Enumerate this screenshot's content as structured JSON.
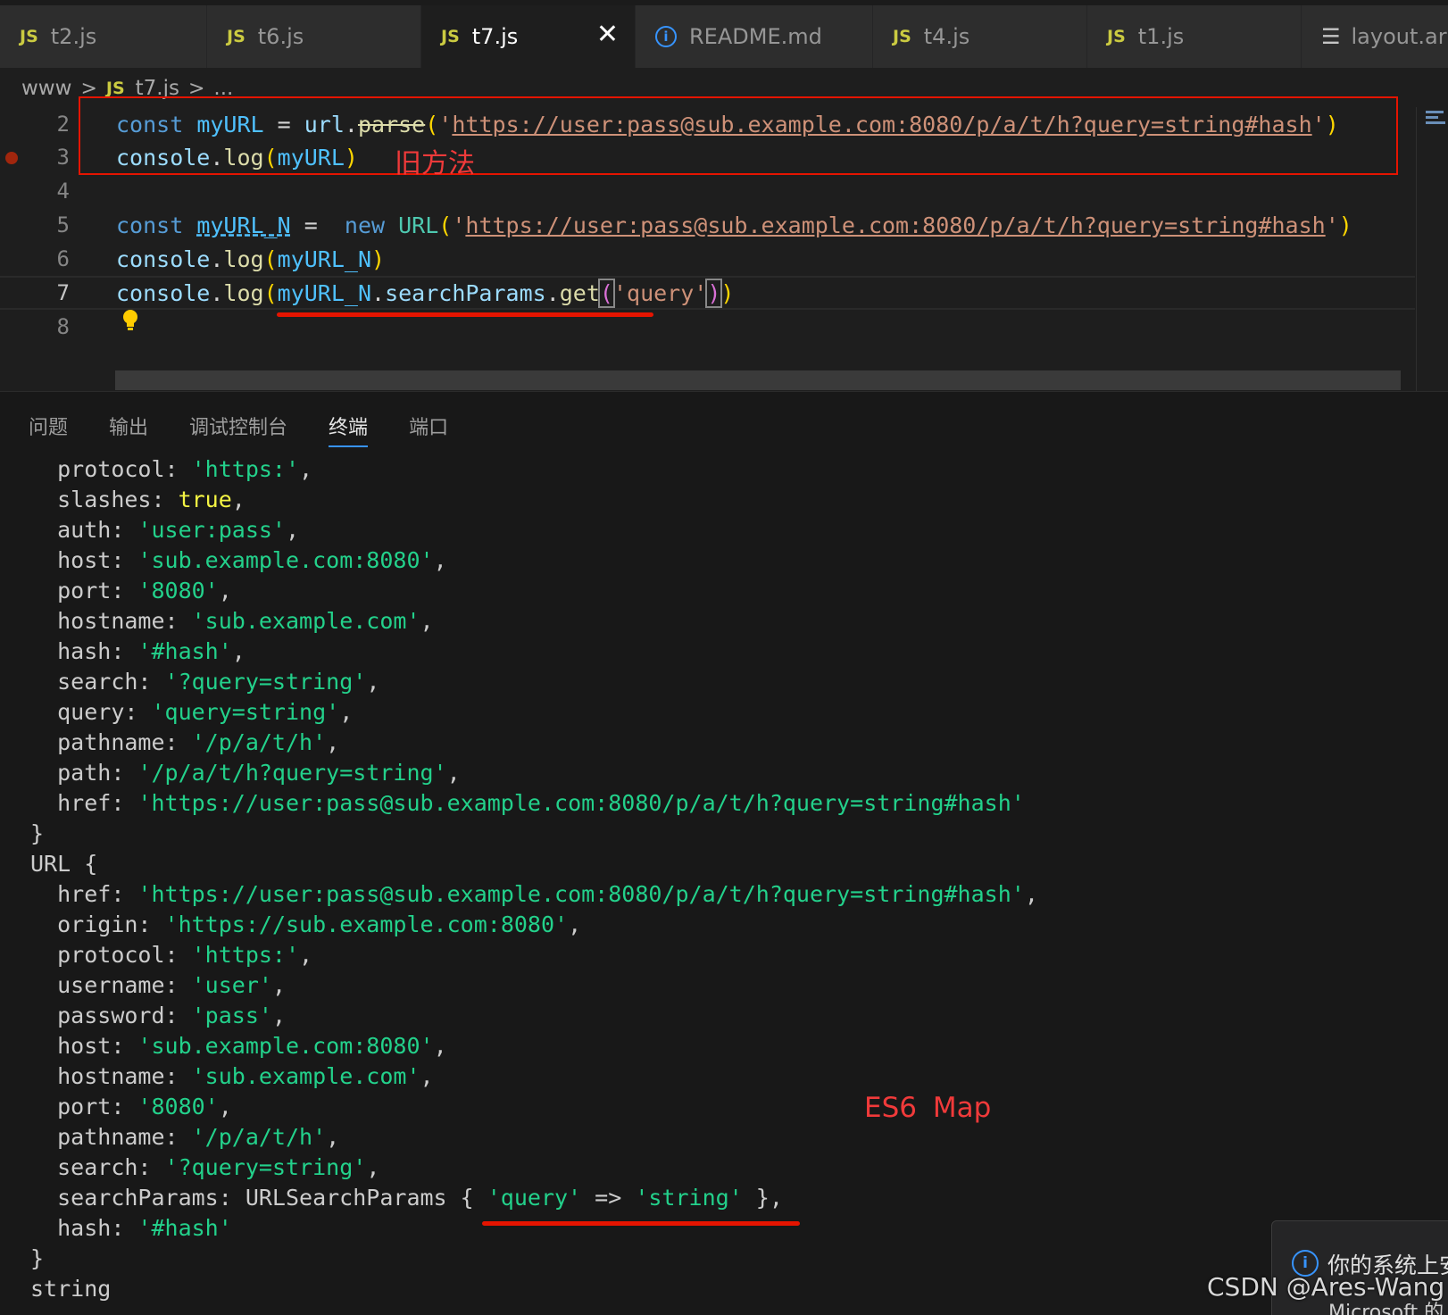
{
  "tabs": [
    {
      "icon": "JS",
      "label": "t2.js"
    },
    {
      "icon": "JS",
      "label": "t6.js"
    },
    {
      "icon": "JS",
      "label": "t7.js",
      "active": true,
      "close": "✕"
    },
    {
      "icon": "i",
      "label": "README.md"
    },
    {
      "icon": "JS",
      "label": "t4.js"
    },
    {
      "icon": "JS",
      "label": "t1.js"
    },
    {
      "icon": "☰",
      "label": "layout.ar"
    }
  ],
  "breadcrumb": {
    "folder": "www",
    "sep": ">",
    "file_icon": "JS",
    "file": "t7.js",
    "more": "..."
  },
  "editor": {
    "line_numbers": [
      "2",
      "3",
      "4",
      "5",
      "6",
      "7",
      "8"
    ],
    "annotation_old": "旧方法",
    "line2": {
      "t1": "const",
      "t2": "myURL",
      "t3": " = ",
      "t4": "url",
      "t5": ".",
      "t6": "parse",
      "t7": "(",
      "t8": "'",
      "t9": "https://user:pass@sub.example.com:8080/p/a/t/h?query=string#hash",
      "t10": "'",
      "t11": ")"
    },
    "line3": {
      "t1": "console",
      "t2": ".",
      "t3": "log",
      "t4": "(",
      "t5": "myURL",
      "t6": ")"
    },
    "line5": {
      "t1": "const",
      "t2": "myURL_N",
      "t3": " =  ",
      "t4": "new",
      "t5": "URL",
      "t6": "(",
      "t7": "'",
      "t8": "https://user:pass@sub.example.com:8080/p/a/t/h?query=string#hash",
      "t9": "'",
      "t10": ")"
    },
    "line6": {
      "t1": "console",
      "t2": ".",
      "t3": "log",
      "t4": "(",
      "t5": "myURL_N",
      "t6": ")"
    },
    "line7": {
      "t1": "console",
      "t2": ".",
      "t3": "log",
      "t4": "(",
      "t5": "myURL_N",
      "t6": ".",
      "t7": "searchParams",
      "t8": ".",
      "t9": "get",
      "t10": "(",
      "t11": "'query'",
      "t12": ")",
      "t13": ")"
    }
  },
  "panel": {
    "tabs": [
      "问题",
      "输出",
      "调试控制台",
      "终端",
      "端口"
    ],
    "active_tab": "终端",
    "annotation_es6": "ES6  Map",
    "notification": "你的系统上安",
    "watermark": "CSDN @Ares-Wang",
    "watermark2": "Microsoft 的"
  },
  "terminal": [
    {
      "indent": "  ",
      "key": "protocol: ",
      "val": "'https:'",
      "tail": ","
    },
    {
      "indent": "  ",
      "key": "slashes: ",
      "kw": "true",
      "tail": ","
    },
    {
      "indent": "  ",
      "key": "auth: ",
      "val": "'user:pass'",
      "tail": ","
    },
    {
      "indent": "  ",
      "key": "host: ",
      "val": "'sub.example.com:8080'",
      "tail": ","
    },
    {
      "indent": "  ",
      "key": "port: ",
      "val": "'8080'",
      "tail": ","
    },
    {
      "indent": "  ",
      "key": "hostname: ",
      "val": "'sub.example.com'",
      "tail": ","
    },
    {
      "indent": "  ",
      "key": "hash: ",
      "val": "'#hash'",
      "tail": ","
    },
    {
      "indent": "  ",
      "key": "search: ",
      "val": "'?query=string'",
      "tail": ","
    },
    {
      "indent": "  ",
      "key": "query: ",
      "val": "'query=string'",
      "tail": ","
    },
    {
      "indent": "  ",
      "key": "pathname: ",
      "val": "'/p/a/t/h'",
      "tail": ","
    },
    {
      "indent": "  ",
      "key": "path: ",
      "val": "'/p/a/t/h?query=string'",
      "tail": ","
    },
    {
      "indent": "  ",
      "key": "href: ",
      "val": "'https://user:pass@sub.example.com:8080/p/a/t/h?query=string#hash'",
      "tail": ""
    },
    {
      "indent": "",
      "key": "}",
      "tail": ""
    },
    {
      "indent": "",
      "key": "URL {",
      "tail": ""
    },
    {
      "indent": "  ",
      "key": "href: ",
      "val": "'https://user:pass@sub.example.com:8080/p/a/t/h?query=string#hash'",
      "tail": ","
    },
    {
      "indent": "  ",
      "key": "origin: ",
      "val": "'https://sub.example.com:8080'",
      "tail": ","
    },
    {
      "indent": "  ",
      "key": "protocol: ",
      "val": "'https:'",
      "tail": ","
    },
    {
      "indent": "  ",
      "key": "username: ",
      "val": "'user'",
      "tail": ","
    },
    {
      "indent": "  ",
      "key": "password: ",
      "val": "'pass'",
      "tail": ","
    },
    {
      "indent": "  ",
      "key": "host: ",
      "val": "'sub.example.com:8080'",
      "tail": ","
    },
    {
      "indent": "  ",
      "key": "hostname: ",
      "val": "'sub.example.com'",
      "tail": ","
    },
    {
      "indent": "  ",
      "key": "port: ",
      "val": "'8080'",
      "tail": ","
    },
    {
      "indent": "  ",
      "key": "pathname: ",
      "val": "'/p/a/t/h'",
      "tail": ","
    },
    {
      "indent": "  ",
      "key": "search: ",
      "val": "'?query=string'",
      "tail": ","
    },
    {
      "indent": "  ",
      "key": "searchParams: URLSearchParams { ",
      "val": "'query'",
      "mid": " => ",
      "val2": "'string'",
      "tail": " },"
    },
    {
      "indent": "  ",
      "key": "hash: ",
      "val": "'#hash'",
      "tail": ""
    },
    {
      "indent": "",
      "key": "}",
      "tail": ""
    },
    {
      "indent": "",
      "key": "string",
      "tail": ""
    }
  ],
  "colors": {
    "accent": "#3794ff",
    "annotation": "#e51400",
    "string_green": "#23d18b"
  }
}
